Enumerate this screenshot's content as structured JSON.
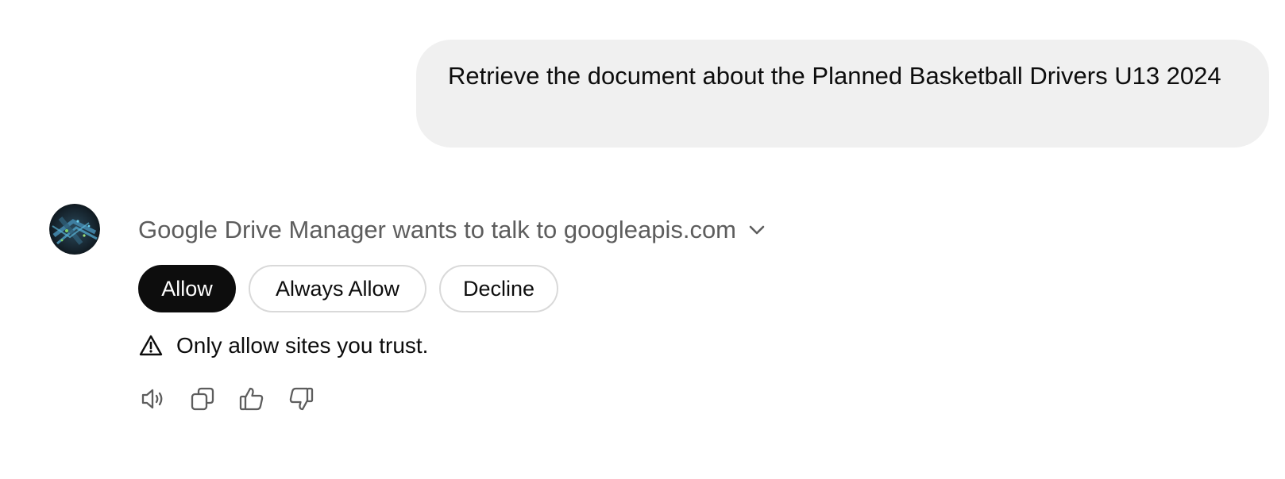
{
  "user_message": {
    "text": "Retrieve the document about the Planned Basketball Drivers U13 2024"
  },
  "assistant": {
    "avatar_icon": "gpt-avatar-icon",
    "permission": {
      "heading": "Google Drive Manager wants to talk to googleapis.com",
      "expand_icon": "chevron-down-icon",
      "buttons": {
        "allow": "Allow",
        "always_allow": "Always Allow",
        "decline": "Decline"
      },
      "warning_icon": "warning-triangle-icon",
      "warning_text": "Only allow sites you trust."
    },
    "actions": [
      "speaker-icon",
      "copy-icon",
      "thumbs-up-icon",
      "thumbs-down-icon"
    ]
  },
  "colors": {
    "bubble_bg": "#f0f0f0",
    "primary_button": "#0d0d0d",
    "muted_text": "#5d5d5d",
    "border": "#d9d9d9"
  }
}
